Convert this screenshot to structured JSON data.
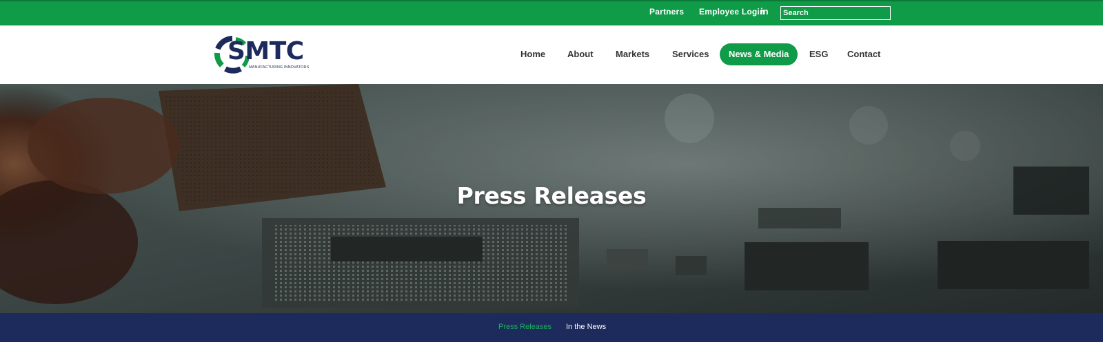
{
  "topbar": {
    "partners_label": "Partners",
    "employee_login_label": "Employee Login",
    "linkedin_glyph": "in",
    "search_placeholder": "Search"
  },
  "logo": {
    "word": "SMTC",
    "tagline": "MANUFACTURING INNOVATORS"
  },
  "nav": {
    "items": [
      {
        "label": "Home"
      },
      {
        "label": "About"
      },
      {
        "label": "Markets"
      },
      {
        "label": "Services"
      },
      {
        "label": "News & Media",
        "active": true
      },
      {
        "label": "ESG"
      },
      {
        "label": "Contact"
      }
    ]
  },
  "hero": {
    "title": "Press Releases"
  },
  "subnav": {
    "tabs": [
      {
        "label": "Press Releases",
        "active": true
      },
      {
        "label": "In the News"
      }
    ]
  },
  "colors": {
    "brand_green": "#0f9b47",
    "brand_navy": "#1d2b5c",
    "active_subnav_text": "#19b05a"
  },
  "icons": {
    "linkedin": "linkedin-icon",
    "logo_mark": "smtc-logo-ring-icon"
  }
}
